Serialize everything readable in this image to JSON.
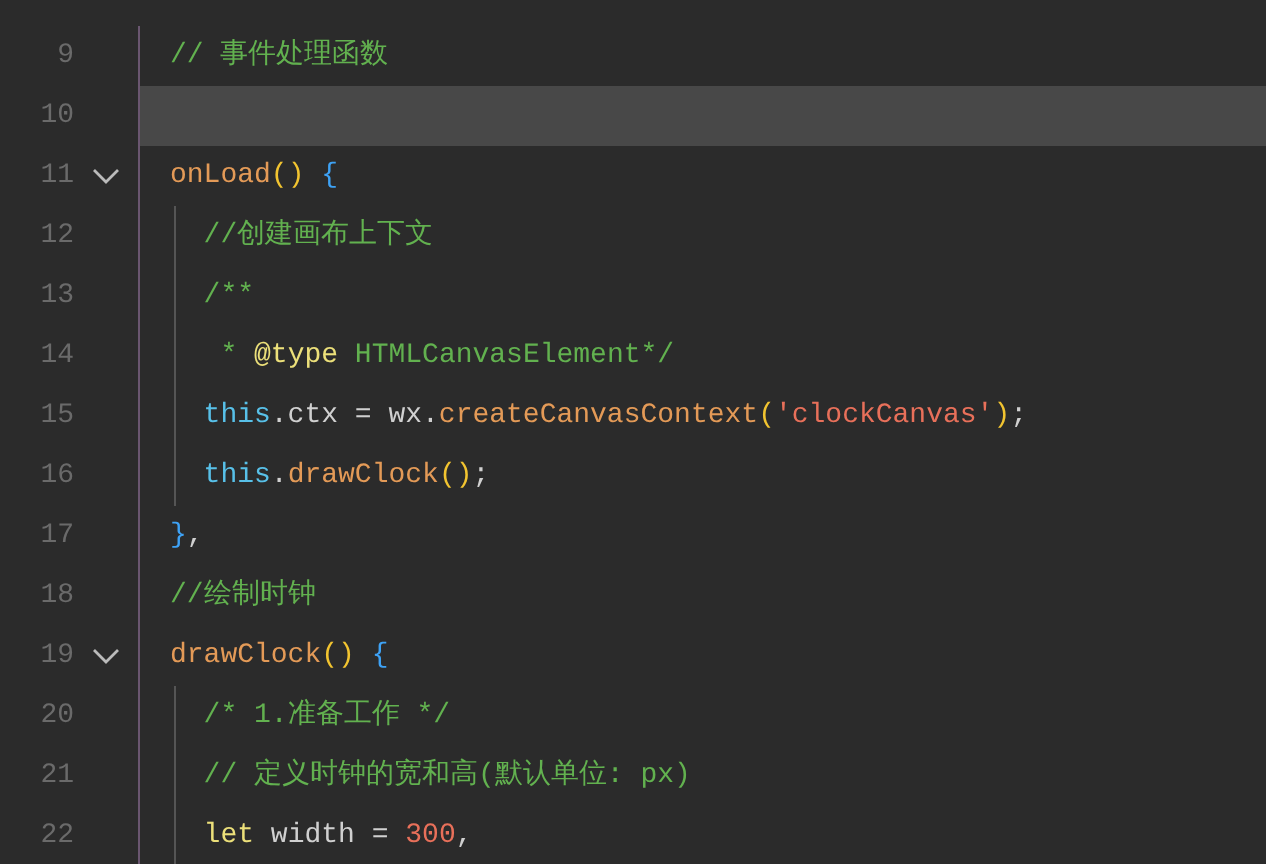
{
  "editor": {
    "lines": [
      {
        "number": "9",
        "foldable": false,
        "highlighted": false,
        "tokens": [
          {
            "kind": "comment",
            "text": "// 事件处理函数"
          }
        ]
      },
      {
        "number": "10",
        "foldable": false,
        "highlighted": true
      },
      {
        "number": "11",
        "foldable": true,
        "highlighted": false,
        "tokens": [
          {
            "kind": "function",
            "text": "onLoad"
          },
          {
            "kind": "paren",
            "text": "() "
          },
          {
            "kind": "brace",
            "text": "{"
          }
        ],
        "children": [
          {
            "number": "12",
            "foldable": false,
            "highlighted": false,
            "tokens": [
              {
                "kind": "comment",
                "text": "//创建画布上下文"
              }
            ]
          },
          {
            "number": "13",
            "foldable": false,
            "highlighted": false,
            "tokens": [
              {
                "kind": "comment",
                "text": "/**"
              }
            ]
          },
          {
            "number": "14",
            "foldable": false,
            "highlighted": false,
            "tokens": [
              {
                "kind": "comment",
                "text": " * "
              },
              {
                "kind": "keyword",
                "text": "@type"
              },
              {
                "kind": "comment",
                "text": " HTMLCanvasElement*/"
              }
            ]
          },
          {
            "number": "15",
            "foldable": false,
            "highlighted": false,
            "tokens": [
              {
                "kind": "this",
                "text": "this"
              },
              {
                "kind": "plain",
                "text": ".ctx = wx."
              },
              {
                "kind": "function",
                "text": "createCanvasContext"
              },
              {
                "kind": "paren",
                "text": "("
              },
              {
                "kind": "string",
                "text": "'clockCanvas'"
              },
              {
                "kind": "paren",
                "text": ")"
              },
              {
                "kind": "plain",
                "text": ";"
              }
            ]
          },
          {
            "number": "16",
            "foldable": false,
            "highlighted": false,
            "tokens": [
              {
                "kind": "this",
                "text": "this"
              },
              {
                "kind": "plain",
                "text": "."
              },
              {
                "kind": "function",
                "text": "drawClock"
              },
              {
                "kind": "paren",
                "text": "()"
              },
              {
                "kind": "plain",
                "text": ";"
              }
            ]
          }
        ]
      },
      {
        "number": "17",
        "foldable": false,
        "highlighted": false,
        "tokens": [
          {
            "kind": "brace",
            "text": "}"
          },
          {
            "kind": "plain",
            "text": ","
          }
        ]
      },
      {
        "number": "18",
        "foldable": false,
        "highlighted": false,
        "tokens": [
          {
            "kind": "comment",
            "text": "//绘制时钟"
          }
        ]
      },
      {
        "number": "19",
        "foldable": true,
        "highlighted": false,
        "tokens": [
          {
            "kind": "function",
            "text": "drawClock"
          },
          {
            "kind": "paren",
            "text": "() "
          },
          {
            "kind": "brace",
            "text": "{"
          }
        ],
        "children": [
          {
            "number": "20",
            "foldable": false,
            "highlighted": false,
            "tokens": [
              {
                "kind": "comment",
                "text": "/* 1.准备工作 */"
              }
            ]
          },
          {
            "number": "21",
            "foldable": false,
            "highlighted": false,
            "tokens": [
              {
                "kind": "comment",
                "text": "// 定义时钟的宽和高(默认单位: px)"
              }
            ]
          },
          {
            "number": "22",
            "foldable": false,
            "highlighted": false,
            "tokens": [
              {
                "kind": "keyword",
                "text": "let"
              },
              {
                "kind": "plain",
                "text": " width = "
              },
              {
                "kind": "number",
                "text": "300"
              },
              {
                "kind": "plain",
                "text": ","
              }
            ]
          }
        ]
      }
    ]
  }
}
